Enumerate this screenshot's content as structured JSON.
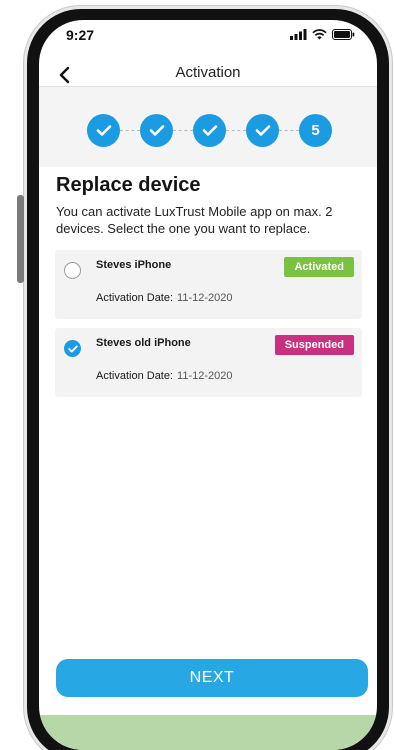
{
  "status_bar": {
    "time": "9:27"
  },
  "header": {
    "title": "Activation"
  },
  "stepper": {
    "completed_steps": 4,
    "current_step": "5"
  },
  "content": {
    "title": "Replace device",
    "description": "You can activate LuxTrust Mobile app on max. 2 devices. Select the one you want to replace."
  },
  "devices": [
    {
      "name": "Steves iPhone",
      "status": "Activated",
      "status_color": "#7cc242",
      "activation_label": "Activation Date:",
      "activation_date": "11-12-2020",
      "selected": false
    },
    {
      "name": "Steves old iPhone",
      "status": "Suspended",
      "status_color": "#c7317f",
      "activation_label": "Activation Date:",
      "activation_date": "11-12-2020",
      "selected": true
    }
  ],
  "footer": {
    "next_label": "NEXT"
  },
  "colors": {
    "accent": "#1a9be2",
    "button": "#27a8e4"
  }
}
